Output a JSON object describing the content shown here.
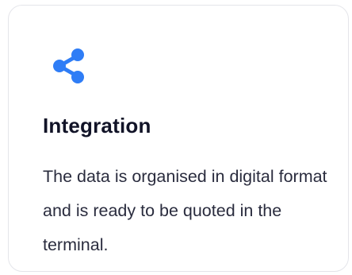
{
  "card": {
    "icon": "share-icon",
    "title": "Integration",
    "description": "The data is organised in digital format and is ready to be quoted in the terminal."
  },
  "colors": {
    "accent": "#2f7df6",
    "title": "#111327",
    "text": "#2a2c3e",
    "border": "#e4e5ea"
  }
}
